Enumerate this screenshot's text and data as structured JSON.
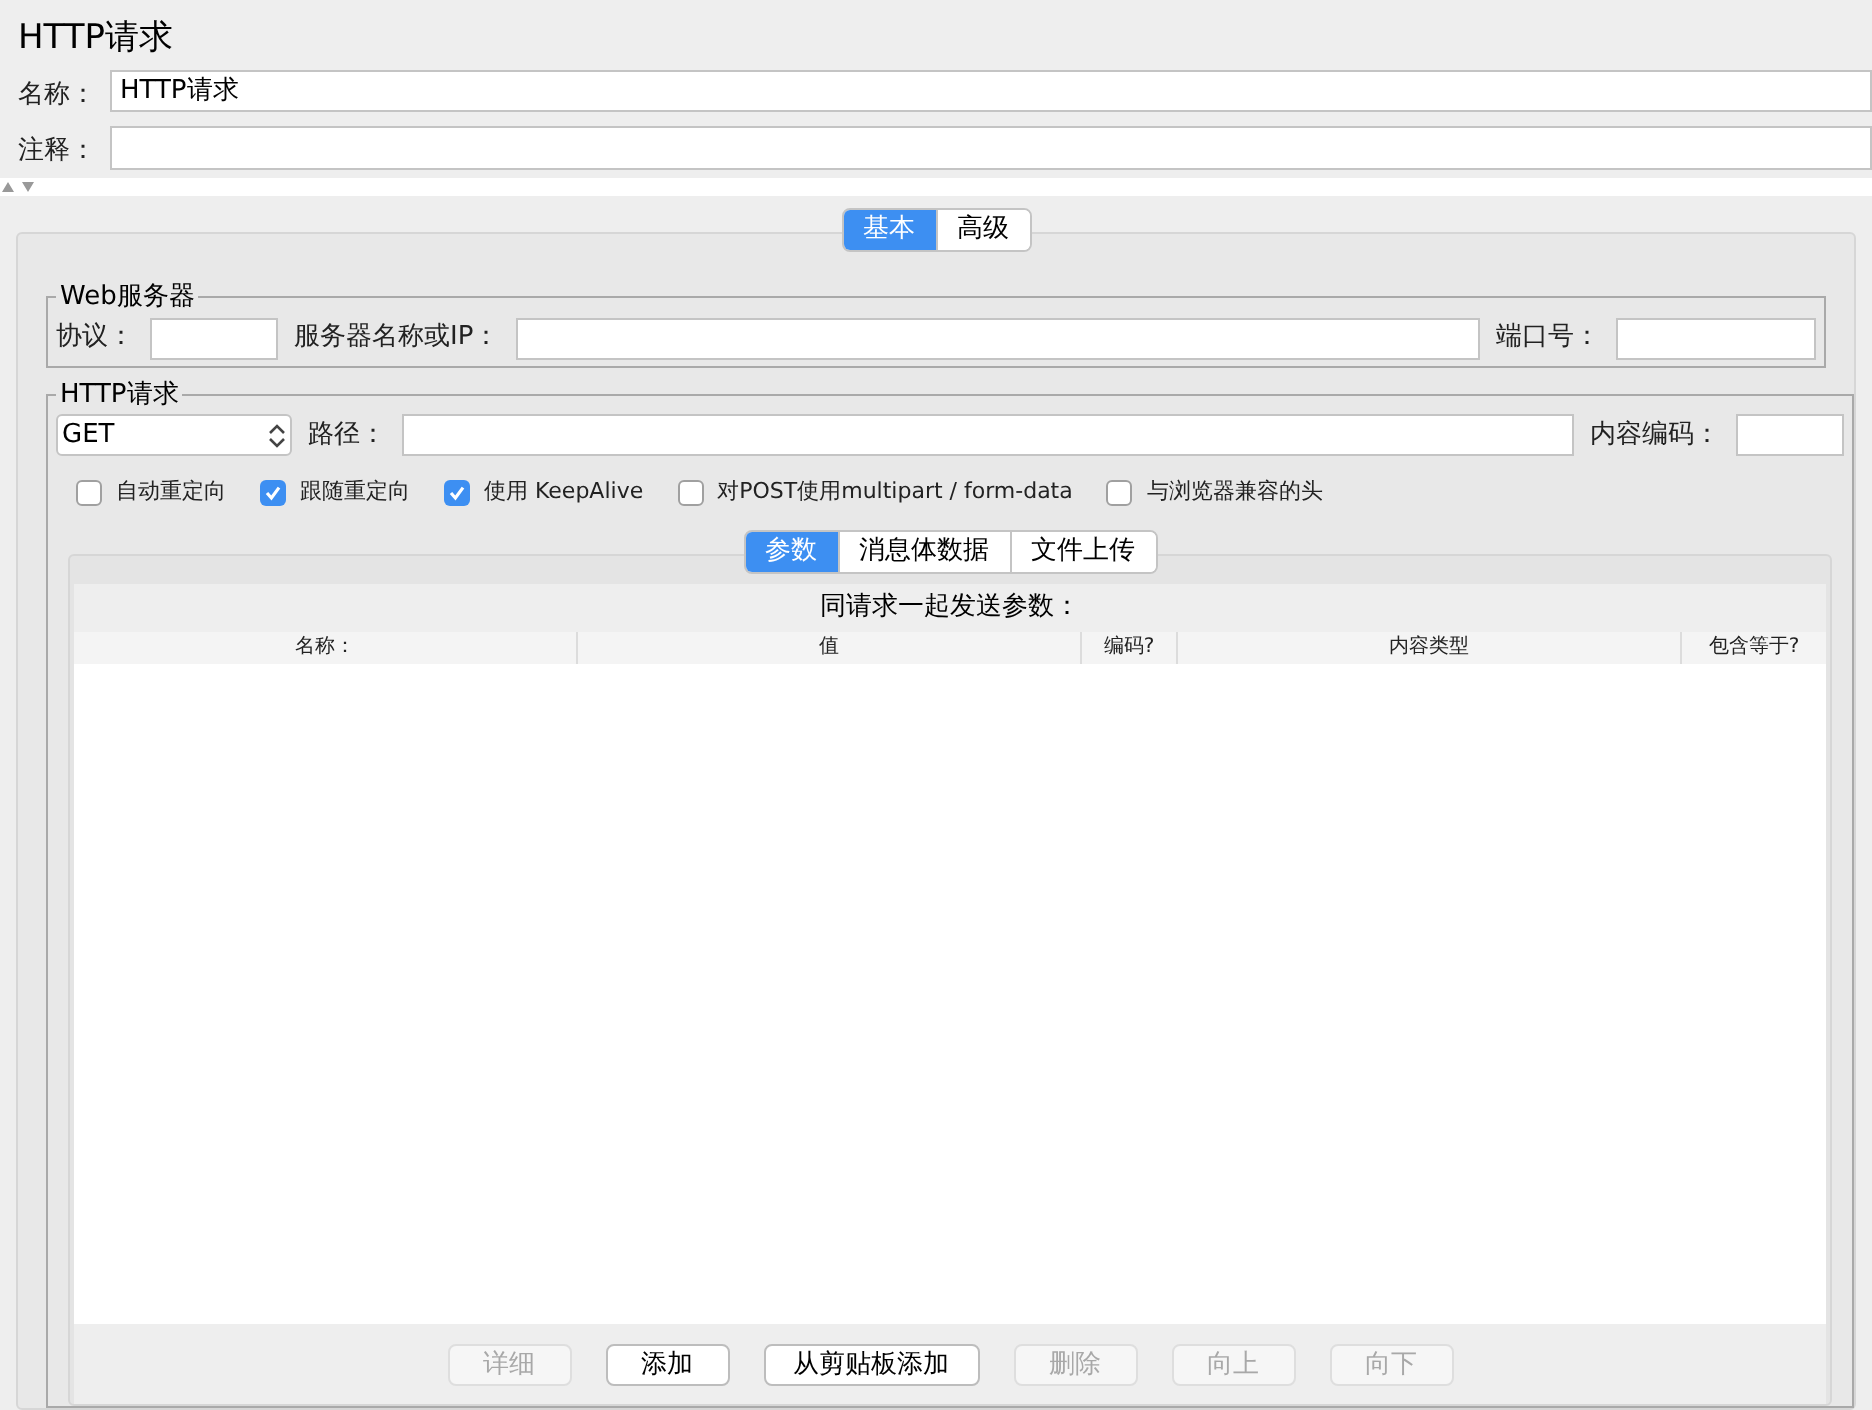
{
  "title": "HTTP请求",
  "name_field": {
    "label": "名称：",
    "value": "HTTP请求"
  },
  "comment_field": {
    "label": "注释："
  },
  "main_tabs": [
    {
      "label": "基本",
      "selected": true
    },
    {
      "label": "高级",
      "selected": false
    }
  ],
  "web_server": {
    "legend": "Web服务器",
    "protocol_label": "协议：",
    "server_label": "服务器名称或IP：",
    "port_label": "端口号："
  },
  "http_request": {
    "legend": "HTTP请求",
    "method": "GET",
    "path_label": "路径：",
    "encoding_label": "内容编码：",
    "options": [
      {
        "label": "自动重定向",
        "checked": false
      },
      {
        "label": "跟随重定向",
        "checked": true
      },
      {
        "label": "使用 KeepAlive",
        "checked": true
      },
      {
        "label": "对POST使用multipart / form-data",
        "checked": false
      },
      {
        "label": "与浏览器兼容的头",
        "checked": false
      }
    ]
  },
  "sub_tabs": [
    {
      "label": "参数",
      "selected": true
    },
    {
      "label": "消息体数据",
      "selected": false
    },
    {
      "label": "文件上传",
      "selected": false
    }
  ],
  "params": {
    "caption": "同请求一起发送参数：",
    "columns": [
      "名称：",
      "值",
      "编码?",
      "内容类型",
      "包含等于?"
    ]
  },
  "buttons": [
    {
      "label": "详细",
      "disabled": true
    },
    {
      "label": "添加",
      "disabled": false
    },
    {
      "label": "从剪贴板添加",
      "disabled": false
    },
    {
      "label": "删除",
      "disabled": true
    },
    {
      "label": "向上",
      "disabled": true
    },
    {
      "label": "向下",
      "disabled": true
    }
  ]
}
